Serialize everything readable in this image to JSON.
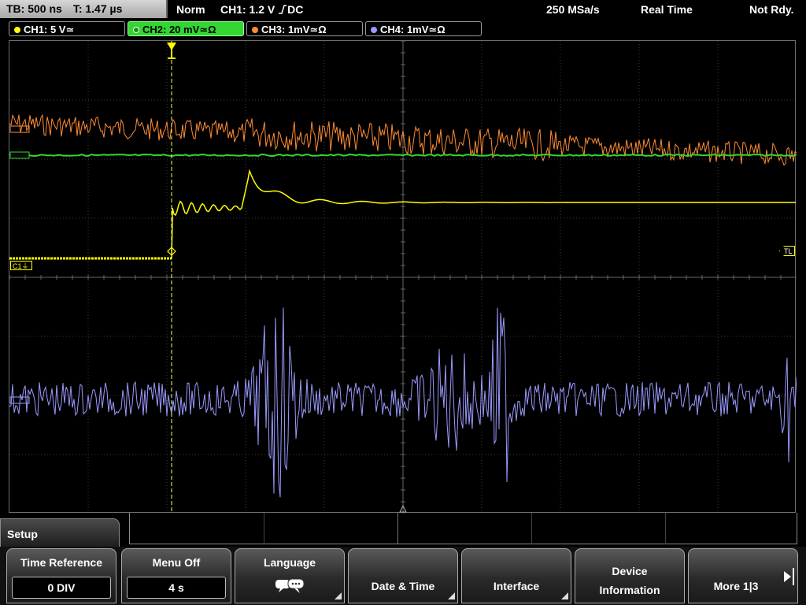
{
  "status": {
    "timebase": "TB: 500 ns",
    "trigger_time": "T: 1.47 µs",
    "mode": "Norm",
    "trigger_source": "CH1: 1.2 V",
    "trigger_coupling": "DC",
    "sample_rate": "250 MSa/s",
    "acq_mode": "Real Time",
    "state": "Not Rdy."
  },
  "channels": [
    {
      "label": "CH1: 5 V≃",
      "color": "#ffff00",
      "active": false
    },
    {
      "label": "CH2: 20 mV≃Ω",
      "color": "#33d633",
      "active": true
    },
    {
      "label": "CH3: 1mV≃Ω",
      "color": "#ff8c33",
      "active": false
    },
    {
      "label": "CH4: 1mV≃Ω",
      "color": "#9a9aff",
      "active": false
    }
  ],
  "markers": {
    "c1_ground": "C1⏚",
    "trigger_level": "TL"
  },
  "menu": {
    "title": "Setup",
    "softkeys": {
      "time_reference": {
        "label": "Time Reference",
        "value": "0 DIV"
      },
      "menu_off": {
        "label": "Menu Off",
        "value": "4 s"
      },
      "language": {
        "label": "Language",
        "icon": "speech-bubble-icon"
      },
      "date_time": {
        "label": "Date & Time"
      },
      "interface": {
        "label": "Interface"
      },
      "device_information": {
        "line1": "Device",
        "line2": "Information"
      },
      "more": {
        "label": "More 1|3"
      }
    }
  },
  "colors": {
    "ch1": "#ffff00",
    "ch2": "#33d633",
    "ch3": "#ff8c33",
    "ch4": "#9a9aff",
    "grid": "#4a4a4a",
    "grid_center": "#7a7a7a"
  }
}
